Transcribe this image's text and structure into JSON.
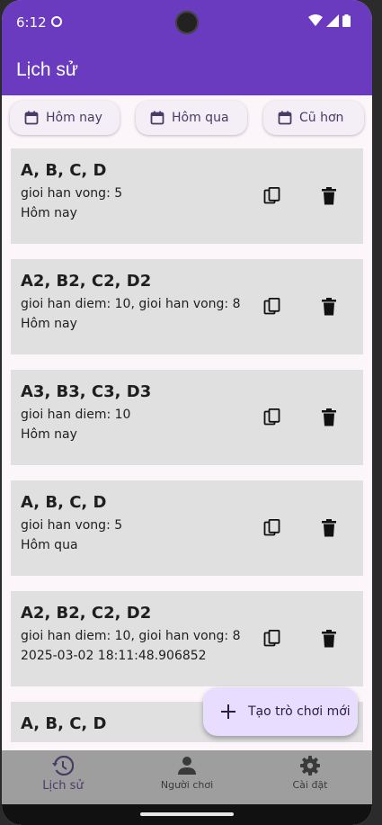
{
  "status_bar": {
    "time": "6:12"
  },
  "app_bar": {
    "title": "Lịch sử"
  },
  "filters": [
    {
      "label": "Hôm nay"
    },
    {
      "label": "Hôm qua"
    },
    {
      "label": "Cũ hơn"
    }
  ],
  "games": [
    {
      "title": "A, B, C, D",
      "line1": "gioi han vong: 5",
      "line2": "Hôm nay"
    },
    {
      "title": "A2, B2, C2, D2",
      "line1": "gioi han diem: 10, gioi han vong: 8",
      "line2": "Hôm nay"
    },
    {
      "title": "A3, B3, C3, D3",
      "line1": "gioi han diem: 10",
      "line2": "Hôm nay"
    },
    {
      "title": "A, B, C, D",
      "line1": "gioi han vong: 5",
      "line2": "Hôm qua"
    },
    {
      "title": "A2, B2, C2, D2",
      "line1": "gioi han diem: 10, gioi han vong: 8",
      "line2": "2025-03-02 18:11:48.906852"
    },
    {
      "title": "A, B, C, D",
      "line1": "",
      "line2": ""
    }
  ],
  "fab": {
    "label": "Tạo trò chơi mới"
  },
  "bottom_nav": [
    {
      "label": "Lịch sử",
      "icon": "history-icon",
      "active": true
    },
    {
      "label": "Người chơi",
      "icon": "person-icon",
      "active": false
    },
    {
      "label": "Cài đặt",
      "icon": "gear-icon",
      "active": false
    }
  ],
  "colors": {
    "primary": "#6a3bbf",
    "card": "#e0e0e0",
    "fab": "#e9ddff",
    "nav": "#9e9e9e"
  }
}
